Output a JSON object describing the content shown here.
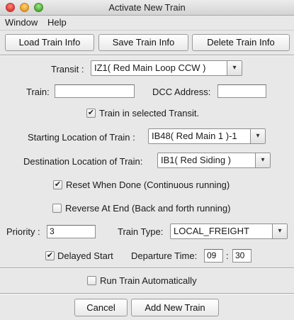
{
  "window": {
    "title": "Activate New Train"
  },
  "menu": {
    "window": "Window",
    "help": "Help"
  },
  "toolbar": {
    "load_label": "Load Train Info",
    "save_label": "Save Train Info",
    "delete_label": "Delete Train Info"
  },
  "form": {
    "transit_label": "Transit :",
    "transit_value": "IZ1( Red Main Loop CCW )",
    "train_label": "Train:",
    "train_value": "",
    "dcc_label": "DCC Address:",
    "dcc_value": "",
    "in_transit_check": "✔",
    "in_transit_label": "Train in selected Transit.",
    "start_label": "Starting Location of Train :",
    "start_value": "IB48( Red Main 1 )-1",
    "dest_label": "Destination Location of Train:",
    "dest_value": "IB1( Red Siding )",
    "reset_check": "✔",
    "reset_label": "Reset When Done (Continuous running)",
    "reverse_check": "",
    "reverse_label": "Reverse At End (Back and forth running)",
    "priority_label": "Priority :",
    "priority_value": "3",
    "train_type_label": "Train Type:",
    "train_type_value": "LOCAL_FREIGHT",
    "delayed_check": "✔",
    "delayed_label": "Delayed Start",
    "departure_label": "Departure Time:",
    "departure_hour": "09",
    "departure_sep": ":",
    "departure_min": "30",
    "auto_check": "",
    "auto_label": "Run Train Automatically"
  },
  "footer": {
    "cancel_label": "Cancel",
    "add_label": "Add New Train"
  },
  "icons": {
    "dropdown": "▾"
  }
}
